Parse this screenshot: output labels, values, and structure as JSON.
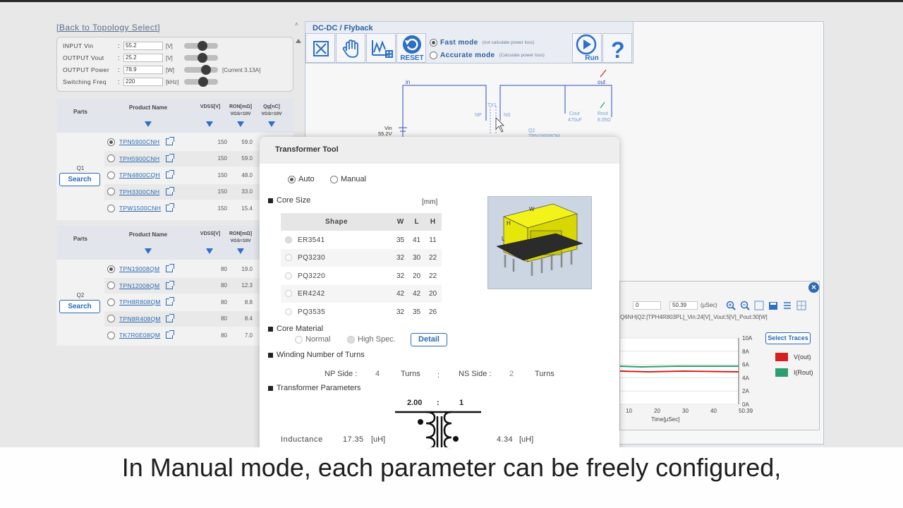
{
  "back_link": "[Back to Topology Select]",
  "params": [
    {
      "label": "INPUT Vin",
      "value": "55.2",
      "unit": "[V]",
      "slider": 0.55,
      "extra": ""
    },
    {
      "label": "OUTPUT Vout",
      "value": "25.2",
      "unit": "[V]",
      "slider": 0.55,
      "extra": ""
    },
    {
      "label": "OUTPUT Power",
      "value": "78.9",
      "unit": "[W]",
      "slider": 0.7,
      "extra": "[Current 3.13A]"
    },
    {
      "label": "Switching Freq",
      "value": "220",
      "unit": "[kHz]",
      "slider": 0.6,
      "extra": ""
    }
  ],
  "table_headers": {
    "parts": "Parts",
    "product_name": "Product Name",
    "vdss": "VDSS[V]",
    "ron": "RON[mΩ]",
    "ron_sub": "VGS=10V",
    "qg": "Qg[nC]",
    "qg_sub": "VGS=10V"
  },
  "q1": {
    "label": "Q1",
    "search": "Search",
    "rows": [
      {
        "name": "TPN5900CNH",
        "vdss": "150",
        "ron": "59.0",
        "selected": true
      },
      {
        "name": "TPH5900CNH",
        "vdss": "150",
        "ron": "59.0",
        "selected": false
      },
      {
        "name": "TPN4800CQH",
        "vdss": "150",
        "ron": "48.0",
        "selected": false
      },
      {
        "name": "TPH3300CNH",
        "vdss": "150",
        "ron": "33.0",
        "selected": false
      },
      {
        "name": "TPW1500CNH",
        "vdss": "150",
        "ron": "15.4",
        "selected": false
      }
    ]
  },
  "q2": {
    "label": "Q2",
    "search": "Search",
    "rows": [
      {
        "name": "TPN19008QM",
        "vdss": "80",
        "ron": "19.0",
        "selected": true
      },
      {
        "name": "TPN12008QM",
        "vdss": "80",
        "ron": "12.3",
        "selected": false
      },
      {
        "name": "TPH8R808QM",
        "vdss": "80",
        "ron": "8.8",
        "selected": false
      },
      {
        "name": "TPN8R408QM",
        "vdss": "80",
        "ron": "8.4",
        "selected": false
      },
      {
        "name": "TK7R0E08QM",
        "vdss": "80",
        "ron": "7.0",
        "selected": false
      }
    ]
  },
  "toolbar": {
    "title": "DC-DC / Flyback",
    "reset": "RESET",
    "run": "Run",
    "fast_mode": "Fast mode",
    "fast_note": "(not calculate power loss)",
    "accurate_mode": "Accurate mode",
    "accurate_note": "(Calculate power loss)"
  },
  "circuit": {
    "in": "in",
    "out": "out",
    "vin": "Vin",
    "vin_val": "55.2V",
    "tx": "TX1",
    "np": "NP",
    "ns": "NS",
    "cout": "Cout",
    "cout_val": "470uF",
    "rout": "Rout",
    "rout_val": "8.05Ω",
    "q2": "Q2",
    "q2_name": "TPN19008QM"
  },
  "modal": {
    "title": "Transformer Tool",
    "auto": "Auto",
    "manual": "Manual",
    "core_size": "Core Size",
    "mm": "[mm]",
    "shape_hdr": "Shape",
    "w_hdr": "W",
    "l_hdr": "L",
    "h_hdr": "H",
    "cores": [
      {
        "shape": "ER3541",
        "w": "35",
        "l": "41",
        "h": "11",
        "selected": true
      },
      {
        "shape": "PQ3230",
        "w": "32",
        "l": "30",
        "h": "22",
        "selected": false
      },
      {
        "shape": "PQ3220",
        "w": "32",
        "l": "20",
        "h": "22",
        "selected": false
      },
      {
        "shape": "ER4242",
        "w": "42",
        "l": "42",
        "h": "20",
        "selected": false
      },
      {
        "shape": "PQ3535",
        "w": "32",
        "l": "35",
        "h": "26",
        "selected": false
      }
    ],
    "core_material": "Core Material",
    "normal": "Normal",
    "high_spec": "High Spec.",
    "detail": "Detail",
    "winding": "Winding Number of Turns",
    "np_side": "NP Side :",
    "np_val": "4",
    "turns": "Turns",
    "sep": ":",
    "ns_side": "NS Side :",
    "ns_val": "2",
    "params_title": "Transformer Parameters",
    "ratio_left": "2.00",
    "ratio_sep": ":",
    "ratio_right": "1",
    "inductance": "Inductance",
    "l_primary": "17.35",
    "l_unit": "[uH]",
    "l_secondary": "4.34",
    "img_w": "W",
    "img_h": "H",
    "img_l": "L"
  },
  "wave": {
    "t_start": "0",
    "t_end": "50.39",
    "t_unit": "(μSec)",
    "info": "Q6NH|Q2:[TPH4R803PL]_Vin:24[V]_Vout:5[V]_Pout:30[W]",
    "select_traces": "Select Traces",
    "legend": [
      {
        "name": "V(out)",
        "color": "#d42020"
      },
      {
        "name": "I(Rout)",
        "color": "#2e9e6e"
      }
    ],
    "y_ticks": [
      "10A",
      "8A",
      "6A",
      "4A",
      "2A",
      "0A"
    ],
    "x_ticks": [
      "10",
      "20",
      "30",
      "40",
      "50.39"
    ],
    "xlabel": "Time[μSec]"
  },
  "caption": "In Manual mode, each parameter can be freely configured,"
}
